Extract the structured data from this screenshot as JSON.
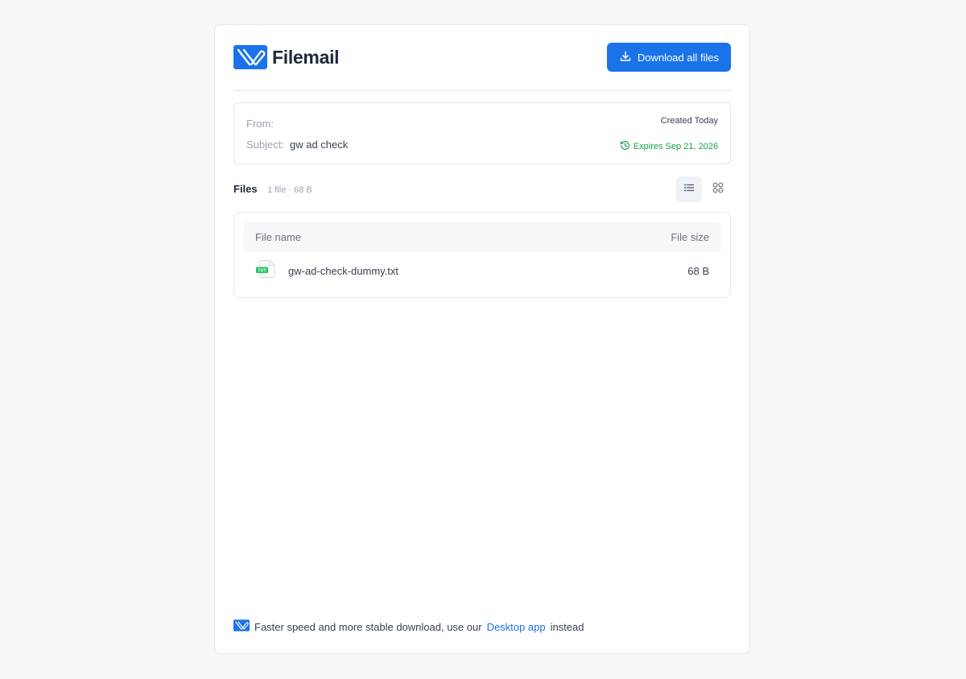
{
  "brand": {
    "name": "Filemail",
    "color": "#1a73e8"
  },
  "header": {
    "download_label": "Download all files"
  },
  "meta": {
    "from_label": "From:",
    "from_value": "",
    "subject_label": "Subject:",
    "subject_value": "gw ad check",
    "created": "Created Today",
    "expires": "Expires Sep 21, 2026"
  },
  "files": {
    "title": "Files",
    "count": "1 file · 68 B",
    "view_modes": [
      "list-icon",
      "grid-icon"
    ],
    "columns": {
      "name": "File name",
      "size": "File size"
    },
    "items": [
      {
        "name": "gw-ad-check-dummy.txt",
        "size": "68 B",
        "type_label": "TXT",
        "icon": "txt-file-icon"
      }
    ]
  },
  "footer": {
    "text_before": "Faster speed and more stable download, use our",
    "link_label": "Desktop app",
    "text_after": "instead"
  },
  "colors": {
    "accent": "#1a73e8",
    "success": "#16a34a",
    "file_badge": "#22c55e"
  }
}
